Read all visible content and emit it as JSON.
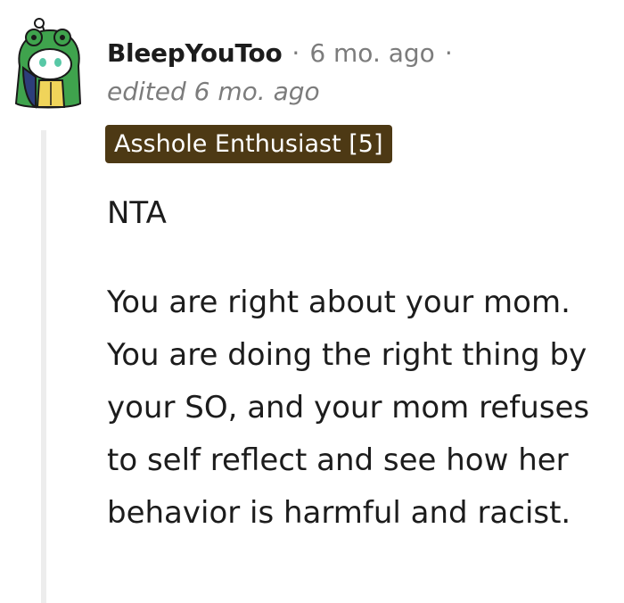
{
  "comment": {
    "author": "BleepYouToo",
    "separator": "·",
    "posted": "6 mo. ago",
    "edited": "edited 6 mo. ago",
    "flair": "Asshole Enthusiast [5]",
    "paragraphs": [
      "NTA",
      "You are right about your mom. You are doing the right thing by your SO, and your mom refuses to self reflect and see how her behavior is harmful and racist."
    ]
  },
  "colors": {
    "flair_background": "#4d3914",
    "thread_line": "#ededed",
    "meta_text": "#7c7c7c",
    "body_text": "#1c1c1c"
  },
  "icons": {
    "avatar": "snoo-avatar-green-frog-hood"
  }
}
